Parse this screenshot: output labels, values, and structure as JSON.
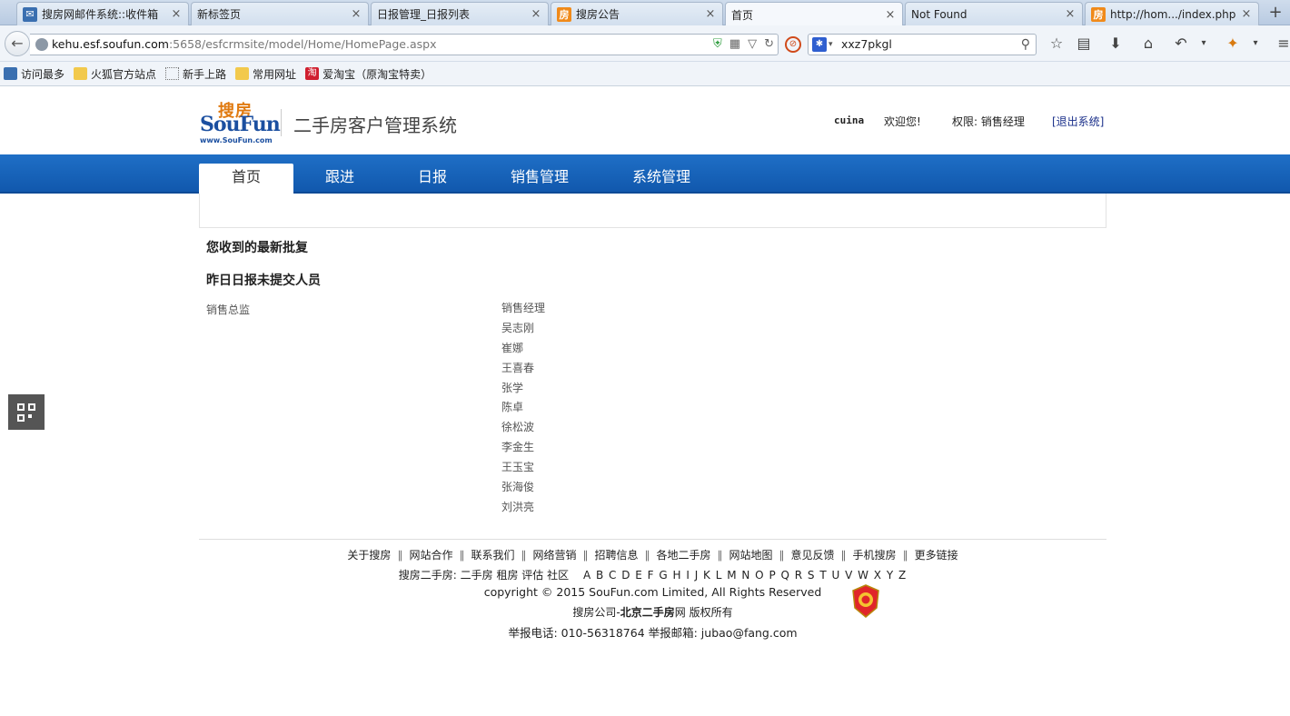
{
  "browser": {
    "tabs": [
      {
        "title": "搜房网邮件系统::收件箱",
        "icon": "mail-icon"
      },
      {
        "title": "新标签页",
        "icon": ""
      },
      {
        "title": "日报管理_日报列表",
        "icon": ""
      },
      {
        "title": "搜房公告",
        "icon": "fang-icon"
      },
      {
        "title": "首页",
        "icon": "",
        "active": true
      },
      {
        "title": "Not Found",
        "icon": ""
      },
      {
        "title": "http://hom.../index.php",
        "icon": "fang-icon"
      }
    ],
    "url_host": "kehu.esf.soufun.com",
    "url_rest": ":5658/esfcrmsite/model/Home/HomePage.aspx",
    "search_value": "xxz7pkgl",
    "bookmarks": [
      "访问最多",
      "火狐官方站点",
      "新手上路",
      "常用网址",
      "爱淘宝（原淘宝特卖）"
    ]
  },
  "header": {
    "logo_cn": "搜房",
    "logo_en": "SouFun",
    "logo_url": "www.SouFun.com",
    "system_title": "二手房客户管理系统",
    "username": "cuina",
    "welcome": "欢迎您!",
    "role": "权限: 销售经理",
    "logout": "[退出系统]"
  },
  "nav": {
    "items": [
      "首页",
      "跟进",
      "日报",
      "销售管理",
      "系统管理"
    ],
    "active_index": 0
  },
  "main": {
    "latest_replies_title": "您收到的最新批复",
    "unsubmitted_title": "昨日日报未提交人员",
    "left_column_label": "销售总监",
    "right_column": [
      "销售经理",
      "吴志刚",
      "崔娜",
      "王喜春",
      "张学",
      "陈卓",
      "徐松波",
      "李金生",
      "王玉宝",
      "张海俊",
      "刘洪亮"
    ]
  },
  "footer": {
    "links": [
      "关于搜房",
      "网站合作",
      "联系我们",
      "网络营销",
      "招聘信息",
      "各地二手房",
      "网站地图",
      "意见反馈",
      "手机搜房",
      "更多链接"
    ],
    "cities_label": "搜房二手房:",
    "cities_links": "二手房 租房 评估 社区",
    "letters": "A B C D E F G H I J K L M N O P Q R S T U V W X Y Z",
    "copyright": "copyright © 2015 SouFun.com Limited, All Rights Reserved",
    "company_prefix": "搜房公司-",
    "company_bold": "北京二手房",
    "company_suffix": "网  版权所有",
    "report": "举报电话: 010-56318764 举报邮箱: jubao@fang.com"
  },
  "colors": {
    "nav_blue": "#1565c0",
    "logo_orange": "#e07a10",
    "logo_blue": "#1b4fa0"
  }
}
